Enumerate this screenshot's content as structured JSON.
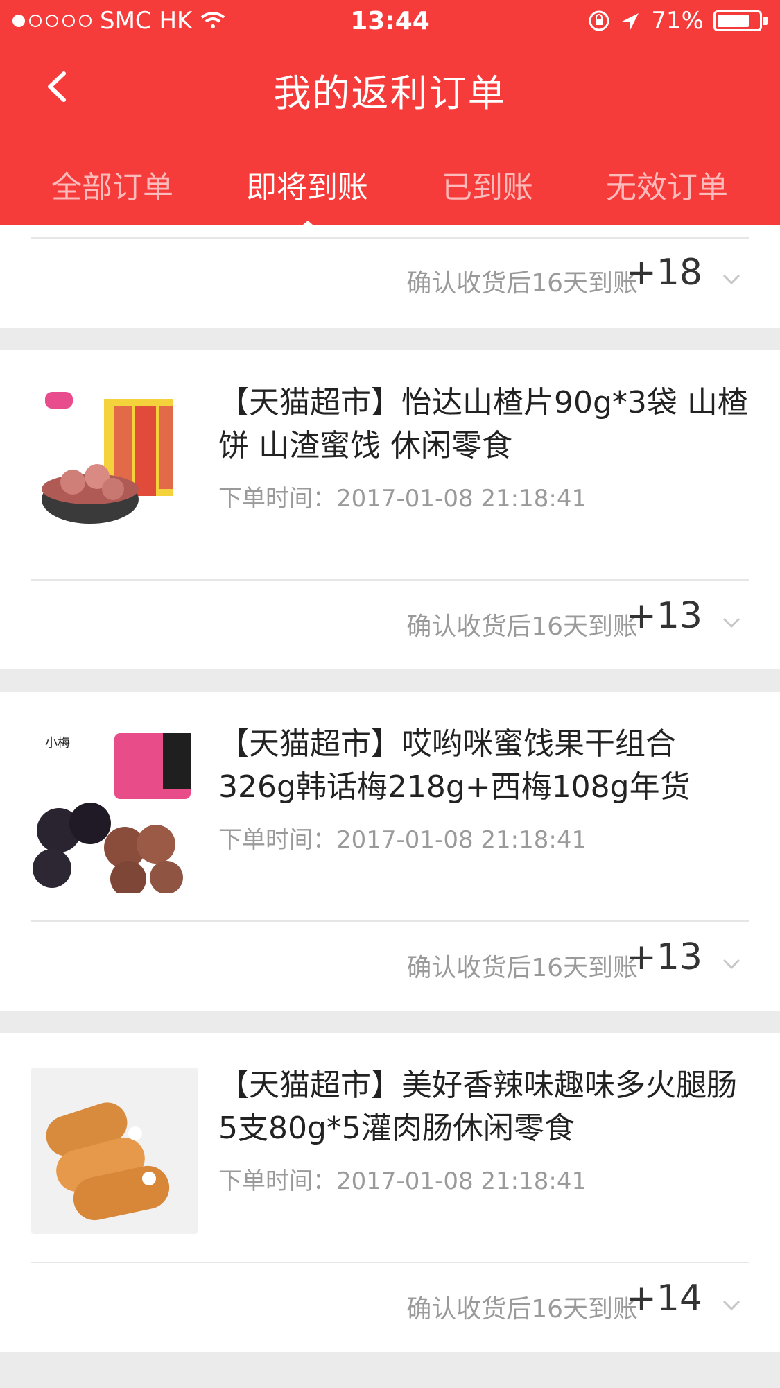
{
  "status_bar": {
    "carrier": "SMC HK",
    "time": "13:44",
    "battery": "71%"
  },
  "header": {
    "title": "我的返利订单",
    "back_icon": "chevron-left-icon"
  },
  "tabs": [
    {
      "label": "全部订单",
      "active": false
    },
    {
      "label": "即将到账",
      "active": true
    },
    {
      "label": "已到账",
      "active": false
    },
    {
      "label": "无效订单",
      "active": false
    }
  ],
  "orders": [
    {
      "rebate_text": "确认收货后16天到账",
      "rebate_amount": "+18"
    },
    {
      "title": "【天猫超市】怡达山楂片90g*3袋 山楂饼 山渣蜜饯 休闲零食",
      "order_time": "下单时间：2017-01-08 21:18:41",
      "rebate_text": "确认收货后16天到账",
      "rebate_amount": "+13"
    },
    {
      "title": "【天猫超市】哎哟咪蜜饯果干组合326g韩话梅218g+西梅108g年货",
      "order_time": "下单时间：2017-01-08 21:18:41",
      "rebate_text": "确认收货后16天到账",
      "rebate_amount": "+13"
    },
    {
      "title": "【天猫超市】美好香辣味趣味多火腿肠5支80g*5灌肉肠休闲零食",
      "order_time": "下单时间：2017-01-08 21:18:41",
      "rebate_text": "确认收货后16天到账",
      "rebate_amount": "+14"
    }
  ],
  "colors": {
    "header_red": "#f63b3b",
    "page_gray": "#ebebeb",
    "muted_text": "#9a9a9a"
  }
}
